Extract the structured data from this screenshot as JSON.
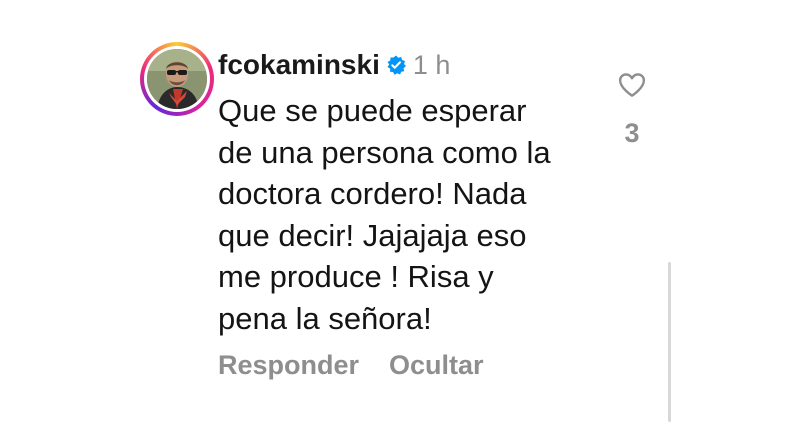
{
  "comment": {
    "username": "fcokaminski",
    "verified": true,
    "timestamp": "1 h",
    "text_lines": [
      "Que se puede esperar",
      "de una persona como la",
      "doctora cordero! Nada",
      "que decir! Jajajaja eso",
      "me produce ! Risa y",
      "pena la señora!"
    ],
    "like_count": "3"
  },
  "actions": {
    "reply_label": "Responder",
    "hide_label": "Ocultar"
  },
  "colors": {
    "verified_blue": "#0095f6",
    "secondary_text": "#8e8e8e",
    "story_ring_start": "#f9ce34",
    "story_ring_mid": "#ee2a7b",
    "story_ring_end": "#6228d7"
  },
  "icons": {
    "like": "heart-outline-icon",
    "verified": "verified-badge-icon"
  }
}
